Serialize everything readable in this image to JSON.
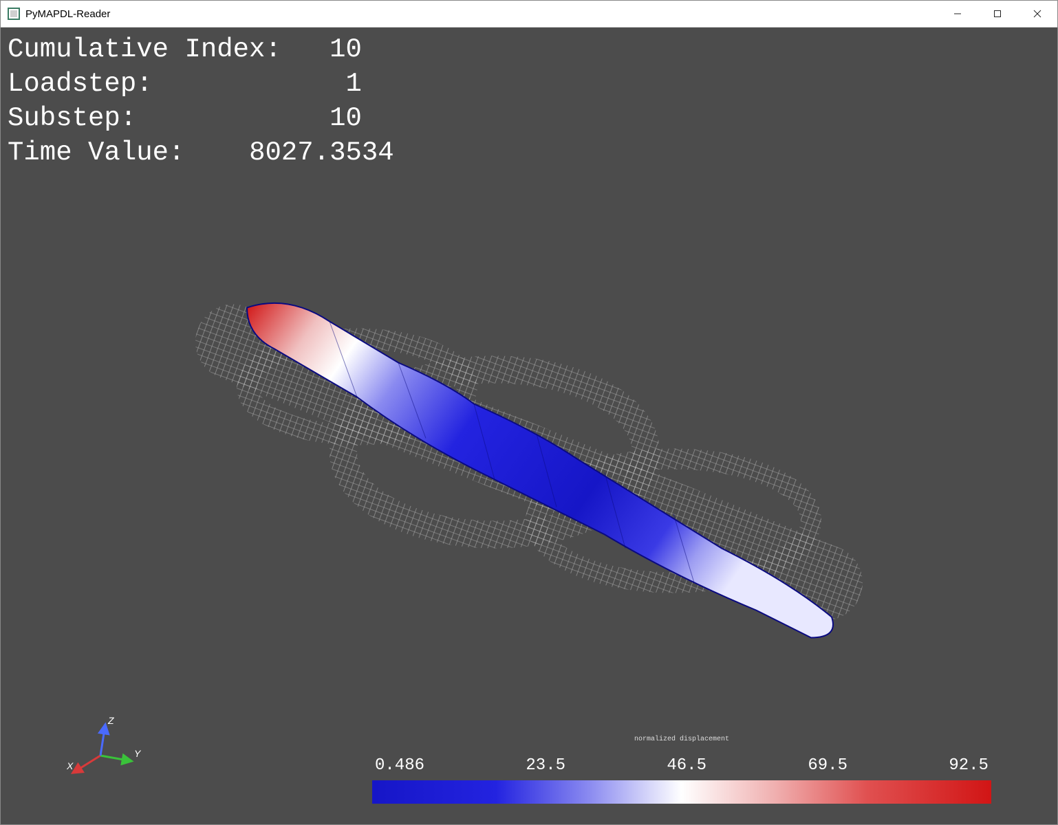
{
  "window": {
    "title": "PyMAPDL-Reader"
  },
  "overlay": {
    "line1_label": "Cumulative Index:",
    "line1_value": "10",
    "line2_label": "Loadstep:",
    "line2_value": "1",
    "line3_label": "Substep:",
    "line3_value": "10",
    "line4_label": "Time Value:",
    "line4_value": "8027.3534"
  },
  "axes": {
    "x": "X",
    "y": "Y",
    "z": "Z"
  },
  "colorbar": {
    "title": "normalized\ndisplacement",
    "ticks": [
      "0.486",
      "23.5",
      "46.5",
      "69.5",
      "92.5"
    ]
  },
  "chart_data": {
    "type": "heatmap",
    "title": "normalized displacement",
    "range": [
      0.486,
      92.5
    ],
    "ticks": [
      0.486,
      23.5,
      46.5,
      69.5,
      92.5
    ],
    "colormap": "coolwarm",
    "result_info": {
      "cumulative_index": 10,
      "loadstep": 1,
      "substep": 10,
      "time_value": 8027.3534
    }
  }
}
